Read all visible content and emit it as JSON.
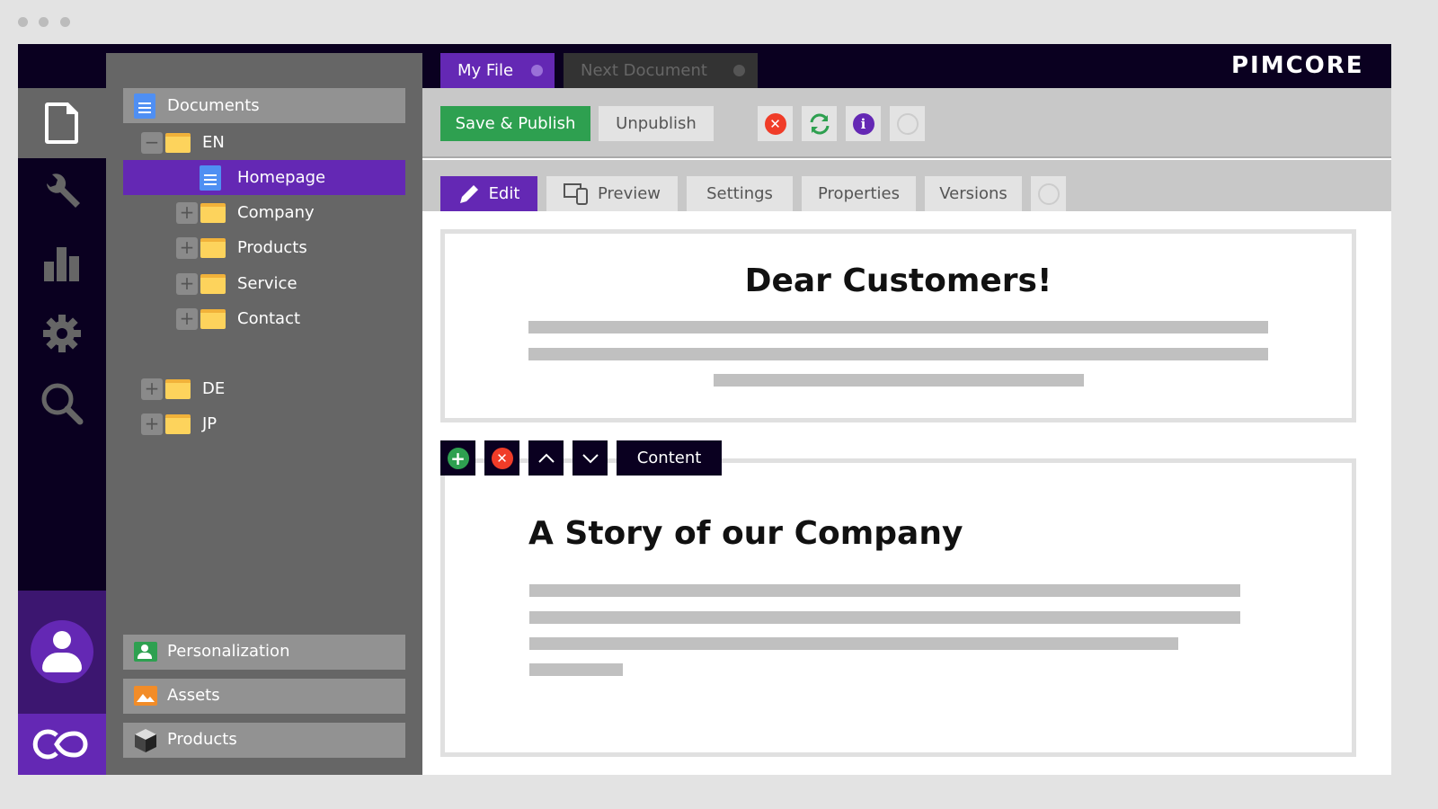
{
  "window": {
    "dots": 3
  },
  "brand": {
    "logo": "PIMCORE",
    "accent": "#6428b4",
    "dark": "#0a0020",
    "green": "#2ea050"
  },
  "rail": {
    "icons": [
      "document-icon",
      "wrench-icon",
      "chart-icon",
      "gear-icon",
      "search-icon",
      "user-avatar-icon",
      "pimcore-logo-icon"
    ]
  },
  "tree": {
    "root": "Documents",
    "items": [
      {
        "label": "EN",
        "type": "folder",
        "expander": "minus"
      },
      {
        "label": "Homepage",
        "type": "document",
        "selected": true
      },
      {
        "label": "Company",
        "type": "folder",
        "expander": "plus"
      },
      {
        "label": "Products",
        "type": "folder",
        "expander": "plus"
      },
      {
        "label": "Service",
        "type": "folder",
        "expander": "plus"
      },
      {
        "label": "Contact",
        "type": "folder",
        "expander": "plus"
      },
      {
        "label": "DE",
        "type": "folder",
        "expander": "plus"
      },
      {
        "label": "JP",
        "type": "folder",
        "expander": "plus"
      }
    ],
    "accordions": [
      "Personalization",
      "Assets",
      "Products"
    ]
  },
  "doc_tabs": [
    {
      "label": "My File",
      "active": true
    },
    {
      "label": "Next Document",
      "active": false
    }
  ],
  "toolbar": {
    "save_publish": "Save & Publish",
    "unpublish": "Unpublish",
    "icons": [
      "close-icon",
      "reload-icon",
      "info-icon",
      "circle-icon"
    ]
  },
  "tabs": [
    "Edit",
    "Preview",
    "Settings",
    "Properties",
    "Versions"
  ],
  "editor": {
    "heading1": "Dear Customers!",
    "block_label": "Content",
    "heading2": "A Story of our Company"
  }
}
